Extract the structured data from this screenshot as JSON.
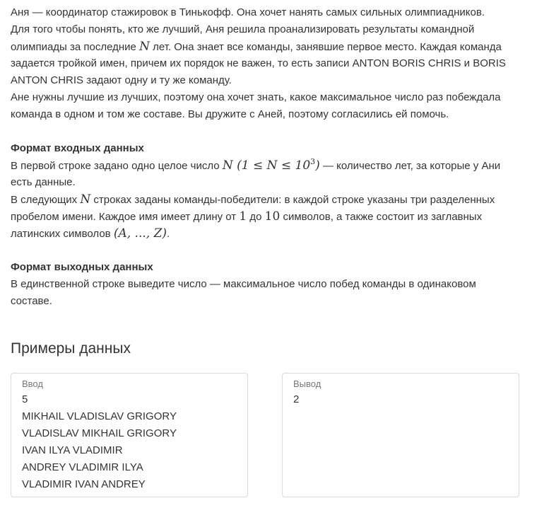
{
  "statement": {
    "p1": {
      "l1": "Аня — координатор стажировок в Тинькофф. Она хочет нанять самых сильных олимпиадников.",
      "l2": "Для того чтобы понять, кто же лучший, Аня решила проанализировать результаты командной",
      "l3_before": "олимпиады за последние",
      "l3_var": "N",
      "l3_after": "лет. Она знает все команды, занявшие первое место. Каждая команда",
      "l4": "задается тройкой имен, причем их порядок не важен, то есть записи ANTON BORIS CHRIS и BORIS",
      "l5": "ANTON CHRIS задают одну и ту же команду.",
      "l6": "Ане нужны лучшие из лучших, поэтому она хочет знать, какое максимальное число раз побеждала",
      "l7": "команда в одном и том же составе. Вы дружите с Аней, поэтому согласились ей помочь."
    },
    "input_heading": "Формат входных данных",
    "input": {
      "l1_before": "В первой строке задано одно целое число",
      "l1_math": "N (1 ≤ N ≤ 10",
      "l1_sup": "3",
      "l1_math_close": ")",
      "l1_after": "— количество лет, за которые у Ани",
      "l2": "есть данные.",
      "l3_before": "В следующих",
      "l3_var": "N",
      "l3_after": "строках заданы команды-победители: в каждой строке указаны три разделенных",
      "l4_before": "пробелом имени. Каждое имя имеет длину от",
      "l4_n1": "1",
      "l4_mid": "до",
      "l4_n2": "10",
      "l4_after": "символов, а также состоит из заглавных",
      "l5_before": "латинских символов",
      "l5_math": "(A, ..., Z)",
      "l5_after": "."
    },
    "output_heading": "Формат выходных данных",
    "output": {
      "l1": "В единственной строке выведите число — максимальное число побед команды в одинаковом",
      "l2": "составе."
    }
  },
  "examples": {
    "title": "Примеры данных",
    "input_label": "Ввод",
    "input_lines": [
      "5",
      "MIKHAIL VLADISLAV GRIGORY",
      "VLADISLAV MIKHAIL GRIGORY",
      "IVAN ILYA VLADIMIR",
      "ANDREY VLADIMIR ILYA",
      "VLADIMIR IVAN ANDREY"
    ],
    "output_label": "Вывод",
    "output_lines": [
      "2"
    ]
  },
  "colors": {
    "text": "#333333",
    "label": "#777777",
    "border": "#dcdcdc"
  }
}
